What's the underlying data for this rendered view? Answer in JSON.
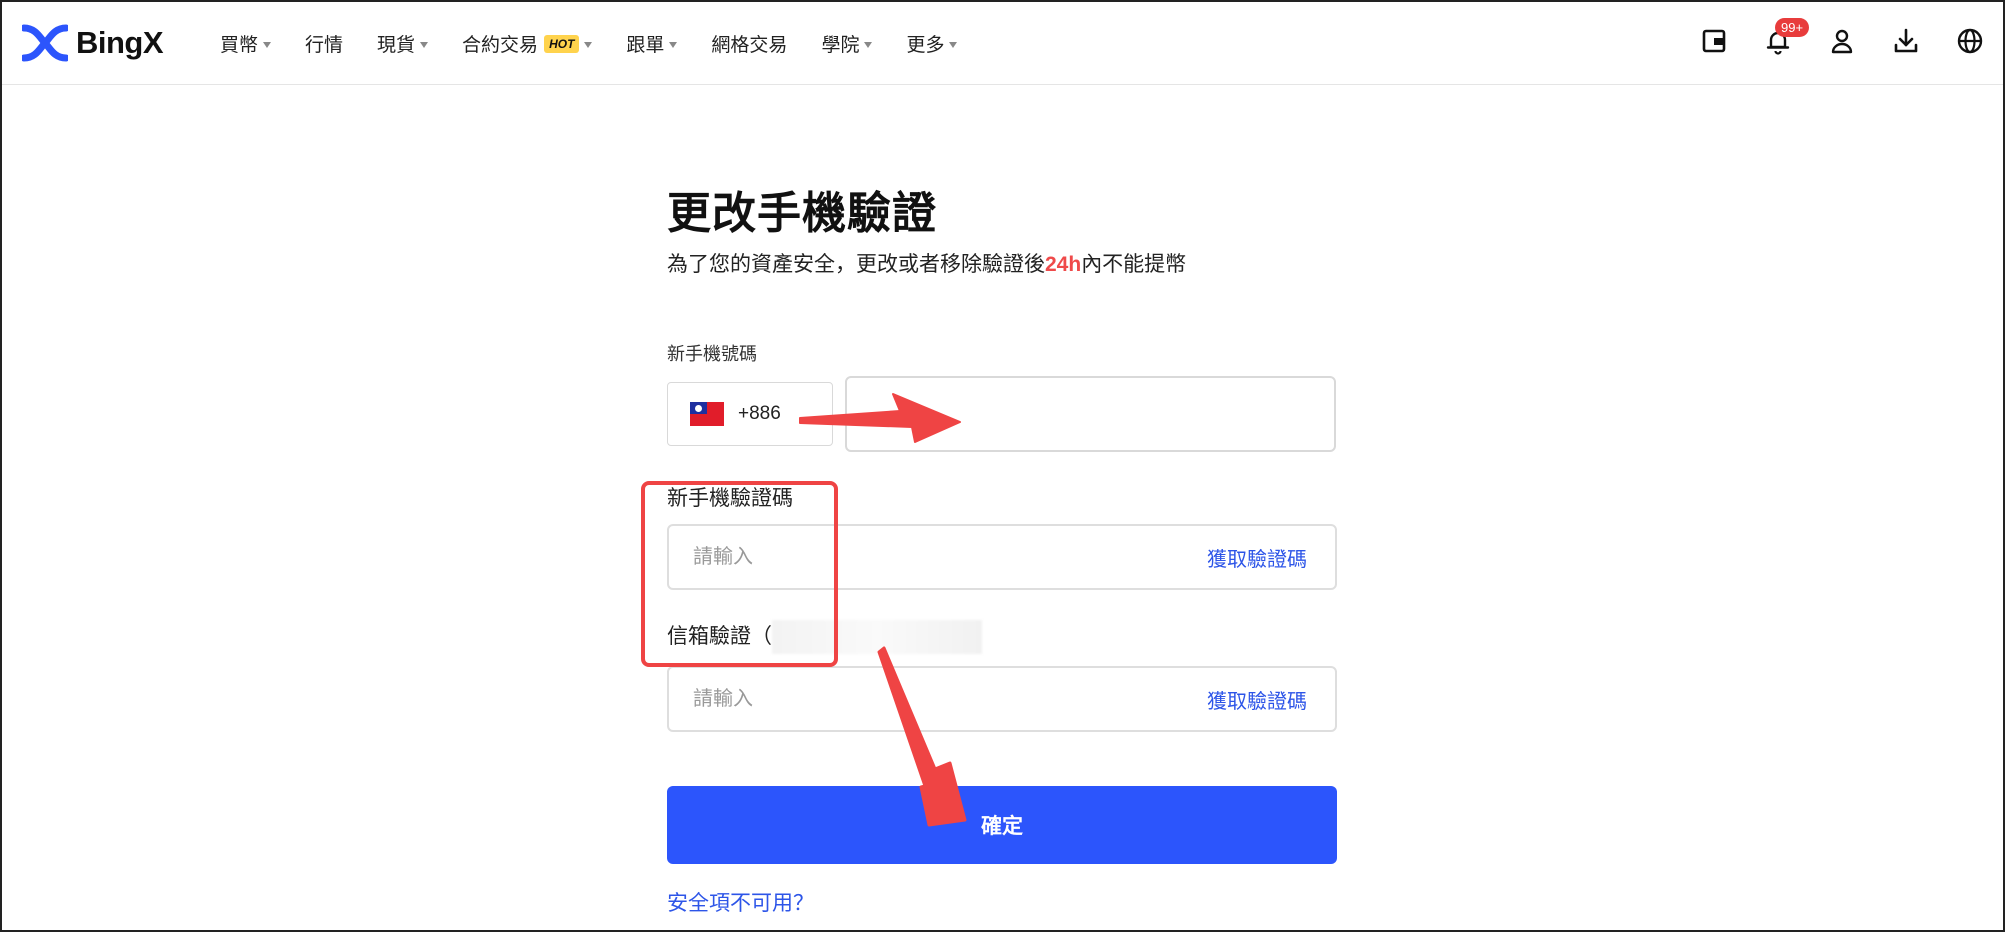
{
  "brand": {
    "name": "BingX"
  },
  "nav": [
    {
      "label": "買幣",
      "dropdown": true
    },
    {
      "label": "行情",
      "dropdown": false
    },
    {
      "label": "現貨",
      "dropdown": true
    },
    {
      "label": "合約交易",
      "dropdown": true,
      "badge": "HOT"
    },
    {
      "label": "跟單",
      "dropdown": true
    },
    {
      "label": "網格交易",
      "dropdown": false
    },
    {
      "label": "學院",
      "dropdown": true
    },
    {
      "label": "更多",
      "dropdown": true
    }
  ],
  "header_icons": {
    "notification_badge": "99+"
  },
  "page": {
    "title": "更改手機驗證",
    "subtitle_before": "為了您的資產安全，更改或者移除驗證後",
    "subtitle_highlight": "24h",
    "subtitle_after": "內不能提幣"
  },
  "phone": {
    "label": "新手機號碼",
    "country_code": "+886",
    "value": ""
  },
  "sms_code": {
    "label": "新手機驗證碼",
    "placeholder": "請輸入",
    "get_code": "獲取驗證碼"
  },
  "email_code": {
    "label": "信箱驗證（",
    "placeholder": "請輸入",
    "get_code": "獲取驗證碼"
  },
  "confirm_label": "確定",
  "unavailable_link": "安全項不可用？",
  "colors": {
    "primary": "#2c55fc",
    "highlight": "#ef4a4a",
    "annotation": "#ef4444",
    "link": "#2d55e8"
  }
}
